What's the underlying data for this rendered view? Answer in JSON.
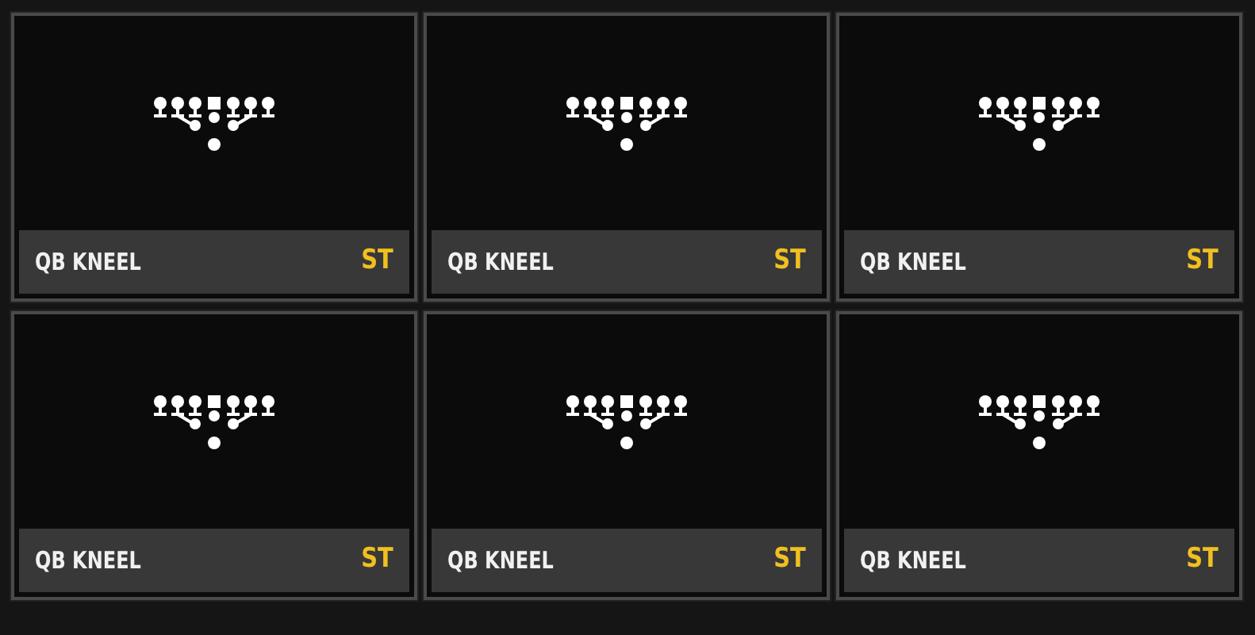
{
  "plays": [
    {
      "name": "QB KNEEL",
      "tag": "ST"
    },
    {
      "name": "QB KNEEL",
      "tag": "ST"
    },
    {
      "name": "QB KNEEL",
      "tag": "ST"
    },
    {
      "name": "QB KNEEL",
      "tag": "ST"
    },
    {
      "name": "QB KNEEL",
      "tag": "ST"
    },
    {
      "name": "QB KNEEL",
      "tag": "ST"
    }
  ]
}
